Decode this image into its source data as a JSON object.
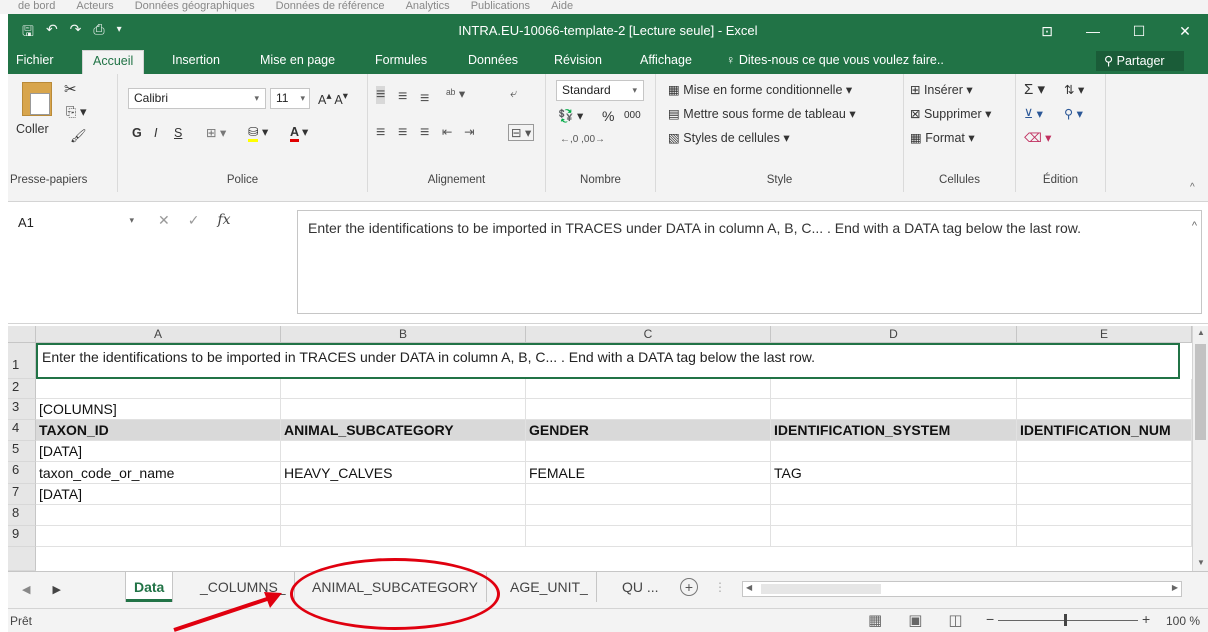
{
  "background_strip": [
    "de bord",
    "Acteurs",
    "Données géographiques",
    "Données de référence",
    "Analytics",
    "Publications",
    "Aide"
  ],
  "window": {
    "title": "INTRA.EU-10066-template-2  [Lecture seule] - Excel",
    "minimize": "—",
    "maximize": "☐",
    "close": "✕"
  },
  "quick_access": {
    "save_icon": "save-icon",
    "undo_icon": "undo-icon",
    "redo_icon": "redo-icon",
    "preview_icon": "print-preview-icon"
  },
  "tabs": [
    "Fichier",
    "Accueil",
    "Insertion",
    "Mise en page",
    "Formules",
    "Données",
    "Révision",
    "Affichage"
  ],
  "active_tab": "Accueil",
  "tell_me": "Dites-nous ce que vous voulez faire..",
  "share": "Partager",
  "ribbon": {
    "clipboard": {
      "label": "Presse-papiers",
      "paste": "Coller"
    },
    "font": {
      "label": "Police",
      "name": "Calibri",
      "size": "11",
      "bold": "G",
      "italic": "I",
      "underline": "S"
    },
    "alignment": {
      "label": "Alignement"
    },
    "number": {
      "label": "Nombre",
      "format": "Standard",
      "percent": "%",
      "thousands": "000"
    },
    "style": {
      "label": "Style",
      "conditional": "Mise en forme conditionnelle",
      "table": "Mettre sous forme de tableau",
      "cell_styles": "Styles de cellules"
    },
    "cells": {
      "label": "Cellules",
      "insert": "Insérer",
      "delete": "Supprimer",
      "format": "Format"
    },
    "editing": {
      "label": "Édition"
    }
  },
  "formula_bar": {
    "name_box": "A1",
    "fx": "fx",
    "content": "Enter the identifications to be imported in TRACES under  DATA in column A, B, C... . End with a DATA tag below the last row."
  },
  "grid": {
    "columns": [
      "A",
      "B",
      "C",
      "D",
      "E"
    ],
    "row_numbers": [
      "1",
      "2",
      "3",
      "4",
      "5",
      "6",
      "7",
      "8",
      "9"
    ],
    "a1_text": "Enter the identifications to be imported in TRACES under  DATA in column A, B, C... . End with a DATA tag below the last row.",
    "rows": [
      [
        "",
        "",
        "",
        "",
        ""
      ],
      [
        "[COLUMNS]",
        "",
        "",
        "",
        ""
      ],
      [
        "TAXON_ID",
        "ANIMAL_SUBCATEGORY",
        "GENDER",
        "IDENTIFICATION_SYSTEM",
        "IDENTIFICATION_NUM"
      ],
      [
        "[DATA]",
        "",
        "",
        "",
        ""
      ],
      [
        "taxon_code_or_name",
        "HEAVY_CALVES",
        "FEMALE",
        "TAG",
        ""
      ],
      [
        "[DATA]",
        "",
        "",
        "",
        ""
      ],
      [
        "",
        "",
        "",
        "",
        ""
      ],
      [
        "",
        "",
        "",
        "",
        ""
      ]
    ]
  },
  "sheet_tabs": [
    "Data",
    "_COLUMNS_",
    "ANIMAL_SUBCATEGORY",
    "AGE_UNIT_",
    "QU ..."
  ],
  "active_sheet": "Data",
  "status": {
    "ready": "Prêt",
    "zoom": "100 %",
    "zoom_percent": 100
  },
  "annotation": {
    "highlight_color": "#e0000f",
    "highlighted_tab": "ANIMAL_SUBCATEGORY"
  },
  "colors": {
    "excel_green": "#217346",
    "header_fill": "#d9d9d9"
  }
}
